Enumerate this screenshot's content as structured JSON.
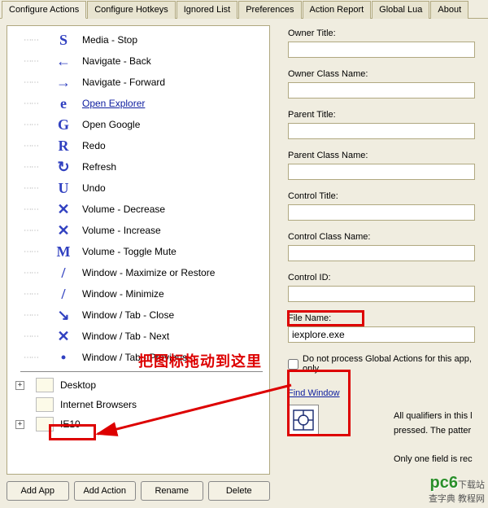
{
  "tabs": {
    "configure_actions": "Configure Actions",
    "configure_hotkeys": "Configure Hotkeys",
    "ignored_list": "Ignored List",
    "preferences": "Preferences",
    "action_report": "Action Report",
    "global_lua": "Global Lua",
    "about": "About"
  },
  "tree": {
    "items": [
      {
        "gesture": "S",
        "label": "Media - Stop",
        "link": false
      },
      {
        "gesture": "←",
        "label": "Navigate - Back",
        "link": false
      },
      {
        "gesture": "→",
        "label": "Navigate - Forward",
        "link": false
      },
      {
        "gesture": "e",
        "label": "Open Explorer",
        "link": true
      },
      {
        "gesture": "G",
        "label": "Open Google",
        "link": false
      },
      {
        "gesture": "R",
        "label": "Redo",
        "link": false
      },
      {
        "gesture": "↻",
        "label": "Refresh",
        "link": false
      },
      {
        "gesture": "U",
        "label": "Undo",
        "link": false
      },
      {
        "gesture": "✕",
        "label": "Volume - Decrease",
        "link": false
      },
      {
        "gesture": "✕",
        "label": "Volume - Increase",
        "link": false
      },
      {
        "gesture": "M",
        "label": "Volume - Toggle Mute",
        "link": false
      },
      {
        "gesture": "/",
        "label": "Window - Maximize or Restore",
        "link": false
      },
      {
        "gesture": "/",
        "label": "Window - Minimize",
        "link": false
      },
      {
        "gesture": "↘",
        "label": "Window / Tab - Close",
        "link": false
      },
      {
        "gesture": "✕",
        "label": "Window / Tab - Next",
        "link": false
      },
      {
        "gesture": "•",
        "label": "Window / Tab - Previous",
        "link": false
      }
    ],
    "groups": [
      {
        "name": "Desktop",
        "expand": true
      },
      {
        "name": "Internet Browsers",
        "expand": false
      },
      {
        "name": "IE10",
        "expand": true
      }
    ]
  },
  "buttons": {
    "add_app": "Add App",
    "add_action": "Add Action",
    "rename": "Rename",
    "delete": "Delete"
  },
  "fields": {
    "owner_title": {
      "label": "Owner Title:",
      "value": ""
    },
    "owner_class_name": {
      "label": "Owner Class Name:",
      "value": ""
    },
    "parent_title": {
      "label": "Parent Title:",
      "value": ""
    },
    "parent_class_name": {
      "label": "Parent Class Name:",
      "value": ""
    },
    "control_title": {
      "label": "Control Title:",
      "value": ""
    },
    "control_class_name": {
      "label": "Control Class Name:",
      "value": ""
    },
    "control_id": {
      "label": "Control ID:",
      "value": ""
    },
    "file_name": {
      "label": "File Name:",
      "value": "iexplore.exe"
    }
  },
  "checkbox": {
    "label": "Do not process Global Actions for this app, only",
    "checked": false
  },
  "find_window": {
    "label": "Find Window"
  },
  "side_text": {
    "line1": "All qualifiers in this l",
    "line2": "pressed. The patter",
    "line3": "Only one field is rec"
  },
  "annotation": {
    "text": "把图标拖动到这里"
  },
  "watermark": {
    "brand": "pc6",
    "sub": "下载站",
    "credit": "查字典  教程网"
  }
}
